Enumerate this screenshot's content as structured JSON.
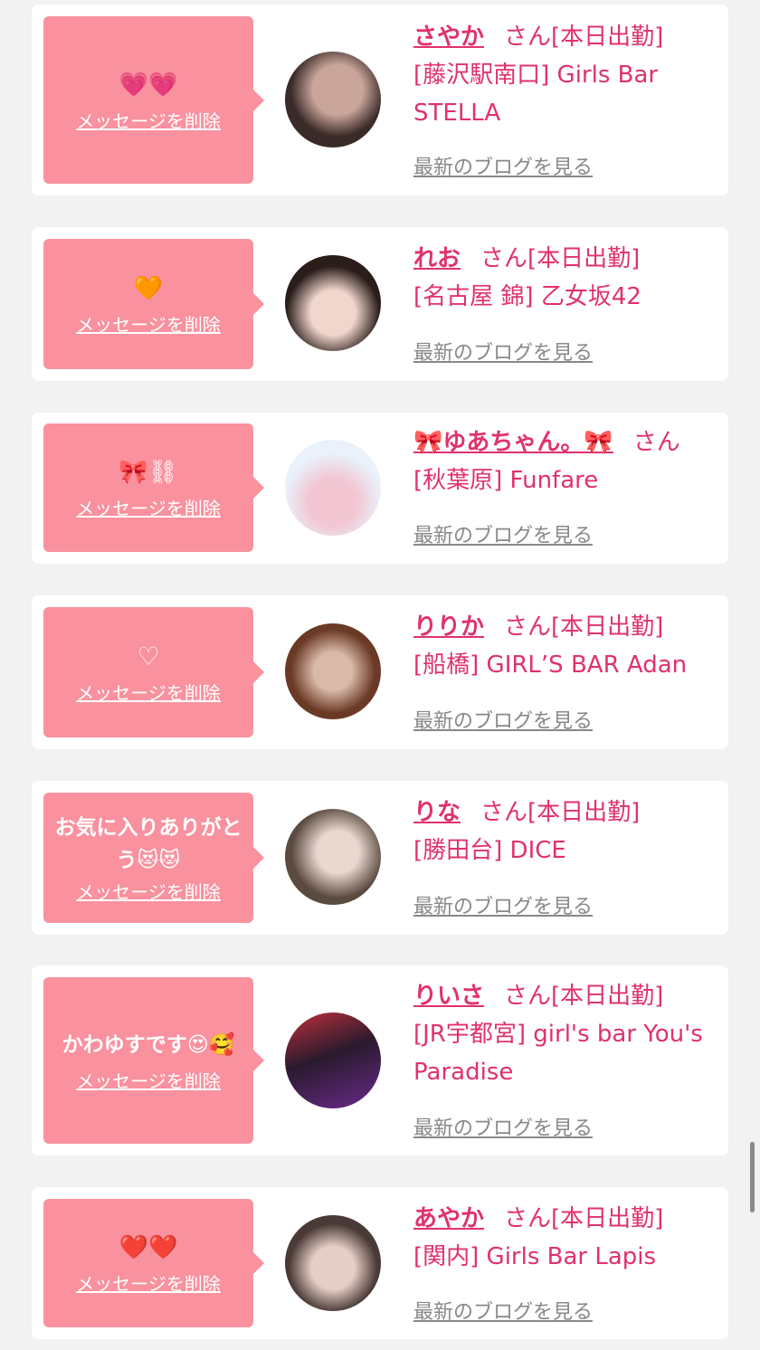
{
  "delete_label": "メッセージを削除",
  "blog_label": "最新のブログを見る",
  "san_label": "さん",
  "cards": [
    {
      "message": "💗💗",
      "name": "さやか",
      "status": "[本日出勤]",
      "shop": "[藤沢駅南口] Girls Bar STELLA",
      "avatar_colors": [
        "#3a2a28",
        "#c9a59a"
      ]
    },
    {
      "message": "🧡",
      "name": "れお",
      "status": "[本日出勤]",
      "shop": "[名古屋 錦] 乙女坂42",
      "avatar_colors": [
        "#2b1d1a",
        "#f0d6cc"
      ]
    },
    {
      "message": "🎀⛓",
      "name": "🎀ゆあちゃん。🎀",
      "status": "",
      "shop": "[秋葉原] Funfare",
      "avatar_colors": [
        "#e9f1fb",
        "#f2c6d2"
      ]
    },
    {
      "message": "♡",
      "name": "りりか",
      "status": "[本日出勤]",
      "shop": "[船橋] GIRL’S BAR Adan",
      "avatar_colors": [
        "#6b3a26",
        "#d9b9a8"
      ]
    },
    {
      "message": "お気に入りありがとう😻😻",
      "name": "りな",
      "status": "[本日出勤]",
      "shop": "[勝田台] DICE",
      "avatar_colors": [
        "#5a4a40",
        "#e8d8d0"
      ]
    },
    {
      "message": "かわゆすです😍🥰",
      "name": "りいさ",
      "status": "[本日出勤]",
      "shop": "[JR宇都宮] girl's bar You's Paradise",
      "avatar_colors": [
        "#2a1a2e",
        "#c0303a"
      ]
    },
    {
      "message": "❤️❤️",
      "name": "あやか",
      "status": "[本日出勤]",
      "shop": "[関内] Girls Bar Lapis",
      "avatar_colors": [
        "#4a3a36",
        "#e6cfc6"
      ]
    }
  ]
}
